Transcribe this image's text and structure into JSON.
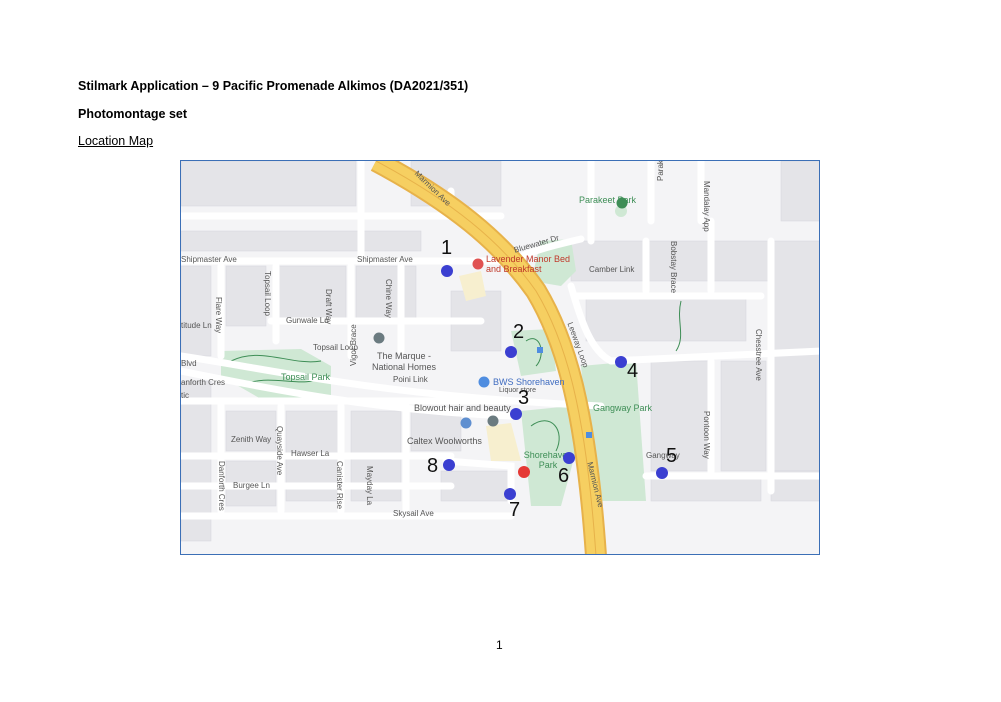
{
  "header": {
    "title": "Stilmark Application – 9 Pacific Promenade Alkimos (DA2021/351)",
    "subtitle": "Photomontage set",
    "map_label": "Location Map"
  },
  "map": {
    "streets": {
      "marmion_top": "Marmion Ave",
      "marmion_bottom": "Marmion Ave",
      "bluewater": "Bluewater Dr",
      "shipmaster": "Shipmaster Ave",
      "camber": "Camber Link",
      "topsail_loop_v": "Topsail Loop",
      "topsail_loop": "Topsail Loop",
      "gunwale": "Gunwale Ln",
      "draft": "Draft Way",
      "chine": "Chine Way",
      "flare": "Flare Way",
      "latitude": "titude Ln",
      "poini": "Poini Link",
      "vigor": "Vigor Brace",
      "zenith": "Zenith Way",
      "hawser": "Hawser La",
      "burgee": "Burgee Ln",
      "danforth": "Danforth Cres",
      "quayside": "Quayside Ave",
      "canister": "Canister Rise",
      "mayday": "Mayday La",
      "skysail": "Skysail Ave",
      "leeway": "Leeway Loop",
      "bobstay": "Bobstay Brace",
      "pontoon": "Pontoon Way",
      "chesstree": "Chesstree Ave",
      "mandalay": "Mandalay App",
      "parakeet_rise": "Parakeet Rise",
      "gangway_st": "Gangway",
      "anforth": "anforth Cres",
      "blvd": "Blvd",
      "tic": "tic"
    },
    "places": {
      "parakeet_park": "Parakeet Park",
      "lavender": "Lavender Manor Bed and Breakfast",
      "marque": "The Marque - National Homes",
      "topsail_park": "Topsail Park",
      "bws": "BWS Shorehaven",
      "bws_sub": "Liquor store",
      "blowout": "Blowout hair and beauty",
      "caltex": "Caltex Woolworths",
      "gangway_park": "Gangway Park",
      "shorehaven_park": "Shorehaven Park"
    },
    "markers": [
      "1",
      "2",
      "3",
      "4",
      "5",
      "6",
      "7",
      "8"
    ],
    "colors": {
      "viewpoint": "#3b3fd1",
      "site": "#e53935",
      "road": "#f6cf61",
      "park": "#cfe8d4"
    }
  },
  "page_number": "1"
}
